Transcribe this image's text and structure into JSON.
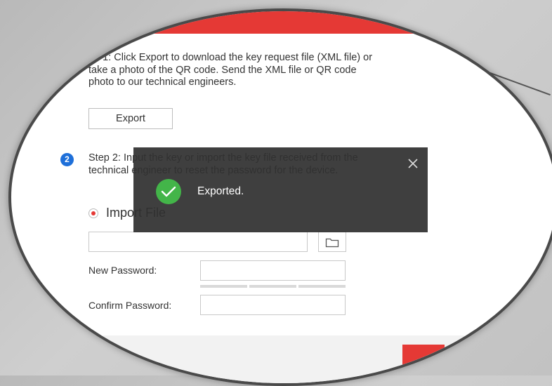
{
  "step1": {
    "text": "ep 1: Click Export to download the key request file (XML file) or take a photo of the QR code. Send the XML file or QR code photo to our technical engineers."
  },
  "export_button": {
    "label": "Export"
  },
  "step2": {
    "badge": "2",
    "text": "Step 2: Input the key or import the key file received from the technical engineer to reset the password for the device."
  },
  "import_option": {
    "label": "Import File",
    "selected": true
  },
  "file_input": {
    "value": "",
    "icon": "folder-icon"
  },
  "new_password": {
    "label": "New Password:",
    "value": ""
  },
  "confirm_password": {
    "label": "Confirm Password:",
    "value": ""
  },
  "toast": {
    "message": "Exported.",
    "status_icon": "check-icon",
    "close_icon": "close-icon"
  },
  "colors": {
    "accent": "#e53935",
    "success": "#43b549",
    "step_badge": "#1e6fd9",
    "toast_bg": "#303030"
  }
}
